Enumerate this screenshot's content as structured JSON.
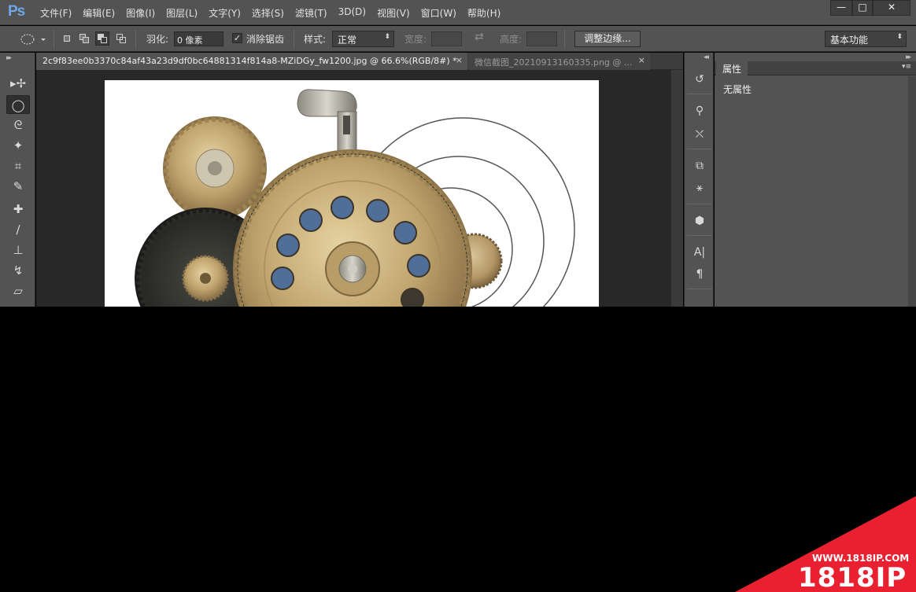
{
  "app": {
    "logo": "Ps"
  },
  "menu": [
    "文件(F)",
    "编辑(E)",
    "图像(I)",
    "图层(L)",
    "文字(Y)",
    "选择(S)",
    "滤镜(T)",
    "3D(D)",
    "视图(V)",
    "窗口(W)",
    "帮助(H)"
  ],
  "window_controls": {
    "minimize": "—",
    "maximize": "□",
    "close": "✕"
  },
  "options": {
    "feather_label": "羽化:",
    "feather_value": "0 像素",
    "antialias_label": "消除锯齿",
    "antialias_checked": true,
    "style_label": "样式:",
    "style_value": "正常",
    "width_label": "宽度:",
    "width_value": "",
    "swap_icon": "⇄",
    "height_label": "高度:",
    "height_value": "",
    "refine_edge_button": "调整边缘...",
    "workspace_value": "基本功能"
  },
  "tools": [
    {
      "icon": "move-icon",
      "glyph": "▸✢"
    },
    {
      "icon": "elliptical-marquee-icon",
      "glyph": "◯"
    },
    {
      "icon": "lasso-icon",
      "glyph": "ᘓ"
    },
    {
      "icon": "magic-wand-icon",
      "glyph": "✦"
    },
    {
      "icon": "crop-icon",
      "glyph": "⌗"
    },
    {
      "icon": "eyedropper-icon",
      "glyph": "✎"
    },
    {
      "icon": "healing-brush-icon",
      "glyph": "✚"
    },
    {
      "icon": "brush-icon",
      "glyph": "∕"
    },
    {
      "icon": "clone-stamp-icon",
      "glyph": "⊥"
    },
    {
      "icon": "history-brush-icon",
      "glyph": "↯"
    },
    {
      "icon": "eraser-icon",
      "glyph": "▱"
    }
  ],
  "tabs": [
    {
      "title": "2c9f83ee0b3370c84af43a23d9df0bc64881314f814a8-MZiDGy_fw1200.jpg @ 66.6%(RGB/8#) *",
      "close": "×",
      "active": true
    },
    {
      "title": "微信截图_20210913160335.png @ ...",
      "close": "×",
      "active": false
    }
  ],
  "right_strip_icons": [
    "history-icon",
    "brushes-icon",
    "brush-presets-icon",
    "clone-source-icon",
    "character-styles-icon",
    "3d-icon",
    "character-icon",
    "paragraph-icon"
  ],
  "right_strip_glyphs": {
    "character": "A|",
    "paragraph": "¶"
  },
  "properties_panel": {
    "tab": "属性",
    "text": "无属性"
  },
  "watermark": {
    "url": "WWW.1818IP.COM",
    "brand": "1818IP"
  },
  "colors": {
    "ui": "#535353",
    "dark": "#282828",
    "accent_red": "#e8202f",
    "ps_blue": "#6ea6e8"
  }
}
